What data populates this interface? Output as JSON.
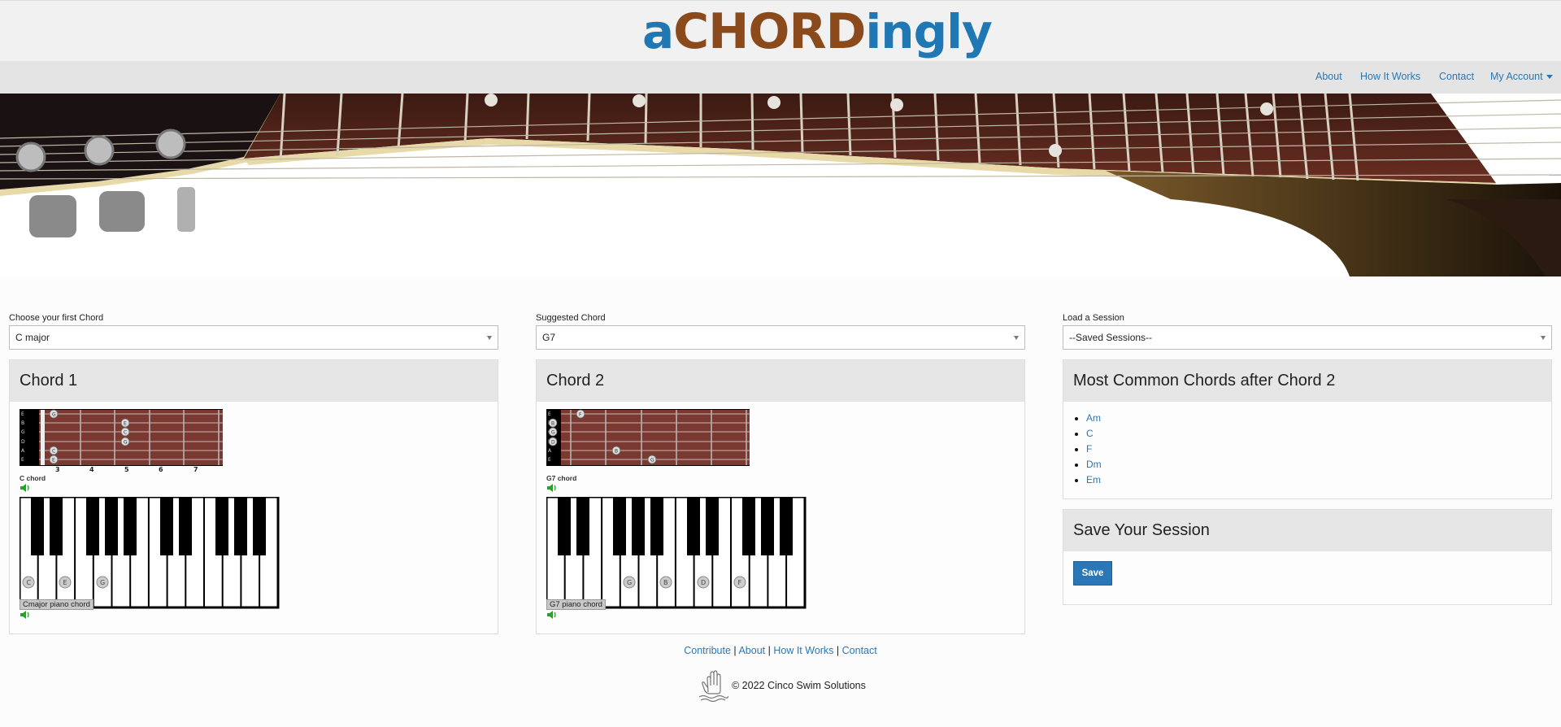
{
  "header": {
    "logo": {
      "part1": "a",
      "part2": "CHORD",
      "part3": "ingly"
    },
    "nav": [
      {
        "label": "About"
      },
      {
        "label": "How It Works"
      },
      {
        "label": "Contact"
      },
      {
        "label": "My Account"
      }
    ]
  },
  "hero": {
    "icon": "guitar-neck-photo"
  },
  "columns": {
    "first": {
      "label": "Choose your first Chord",
      "selected": "C major",
      "panel_title": "Chord 1",
      "fretboard_caption": "C chord",
      "fret_numbers": [
        "3",
        "4",
        "5",
        "6",
        "7"
      ],
      "string_names": [
        "E",
        "B",
        "G",
        "D",
        "A",
        "E"
      ],
      "fret_notes": [
        "G",
        "E",
        "C",
        "G",
        "C",
        "E"
      ],
      "piano_caption": "Cmajor piano chord",
      "piano_notes": [
        "C",
        "E",
        "G"
      ]
    },
    "second": {
      "label": "Suggested Chord",
      "selected": "G7",
      "panel_title": "Chord 2",
      "fretboard_caption": "G7 chord",
      "string_names": [
        "E",
        "B",
        "G",
        "D",
        "A",
        "E"
      ],
      "fret_notes": [
        "F",
        "B",
        "G",
        "D",
        "B",
        "G"
      ],
      "piano_caption": "G7 piano chord",
      "piano_notes": [
        "G",
        "B",
        "D",
        "F"
      ]
    },
    "third": {
      "label": "Load a Session",
      "selected": "--Saved Sessions--",
      "common_title": "Most Common Chords after Chord 2",
      "common_chords": [
        "Am",
        "C",
        "F",
        "Dm",
        "Em"
      ],
      "save_title": "Save Your Session",
      "save_button": "Save"
    }
  },
  "footer": {
    "links": [
      "Contribute",
      "About",
      "How It Works",
      "Contact"
    ],
    "separator": "|",
    "copyright": "© 2022 Cinco Swim Solutions"
  },
  "colors": {
    "link": "#2a77b8",
    "logo_blue": "#1f77b4",
    "logo_brown": "#8b4a1c",
    "sound_green": "#1fa81f",
    "fretboard": "#7a3a32"
  }
}
